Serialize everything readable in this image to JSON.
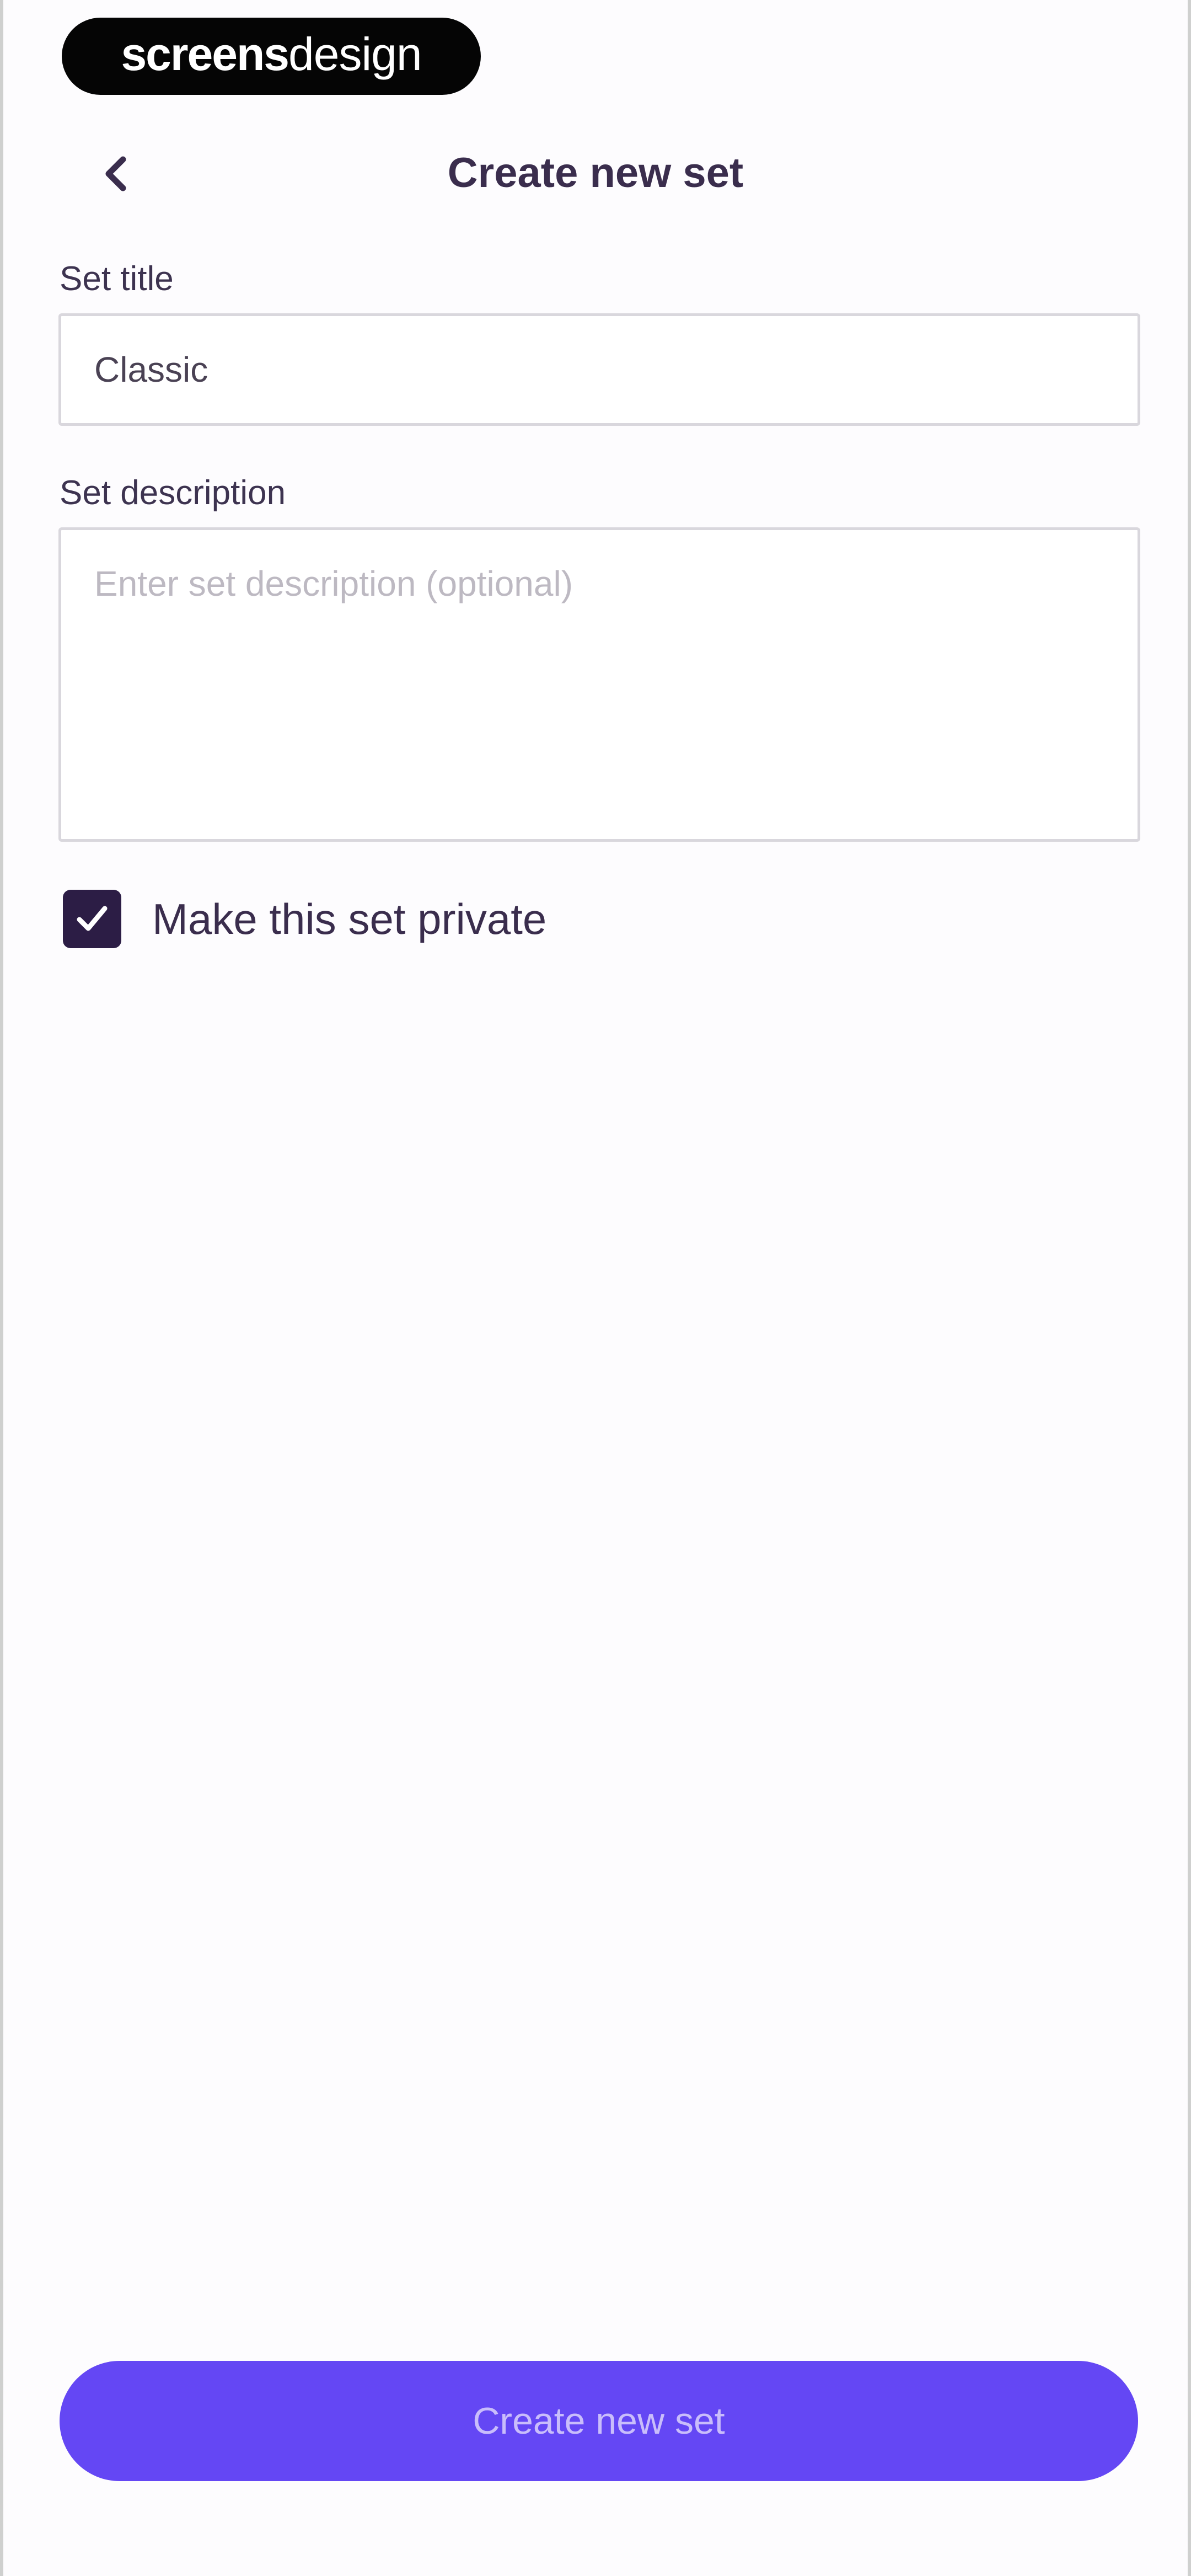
{
  "brand": {
    "part1": "screens",
    "part2": "design"
  },
  "header": {
    "back_icon": "chevron-left-icon",
    "title": "Create new set"
  },
  "form": {
    "title_label": "Set title",
    "title_value": "Classic",
    "description_label": "Set description",
    "description_placeholder": "Enter set description (optional)",
    "private_checked": true,
    "private_label": "Make this set private",
    "check_icon": "checkmark-icon"
  },
  "actions": {
    "submit_label": "Create new set"
  },
  "colors": {
    "accent": "#6447f4",
    "checkbox": "#2c1d45",
    "text": "#3a2d4d"
  }
}
